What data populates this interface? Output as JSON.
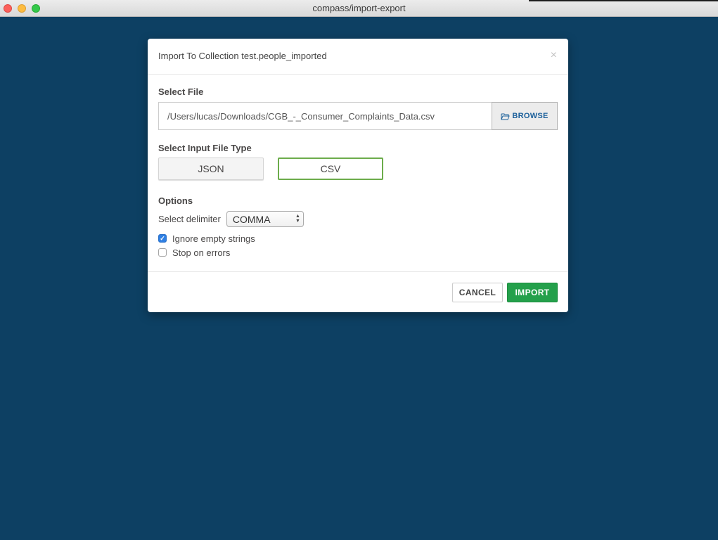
{
  "window": {
    "title": "compass/import-export"
  },
  "modal": {
    "title": "Import To Collection test.people_imported",
    "close_symbol": "×",
    "select_file": {
      "label": "Select File",
      "path": "/Users/lucas/Downloads/CGB_-_Consumer_Complaints_Data.csv",
      "browse_label": "BROWSE",
      "browse_icon": "folder-open-icon"
    },
    "file_type": {
      "label": "Select Input File Type",
      "options": [
        "JSON",
        "CSV"
      ],
      "selected": "CSV"
    },
    "options": {
      "label": "Options",
      "delimiter_label": "Select delimiter",
      "delimiter_value": "COMMA",
      "ignore_empty": {
        "label": "Ignore empty strings",
        "checked": true
      },
      "stop_on_errors": {
        "label": "Stop on errors",
        "checked": false
      }
    },
    "footer": {
      "cancel_label": "CANCEL",
      "import_label": "IMPORT"
    }
  },
  "colors": {
    "background": "#0d4063",
    "accent_green": "#24a04b",
    "selected_border": "#6cac4b",
    "browse_text": "#1a5f9a",
    "checkbox_blue": "#2f7fe3"
  }
}
